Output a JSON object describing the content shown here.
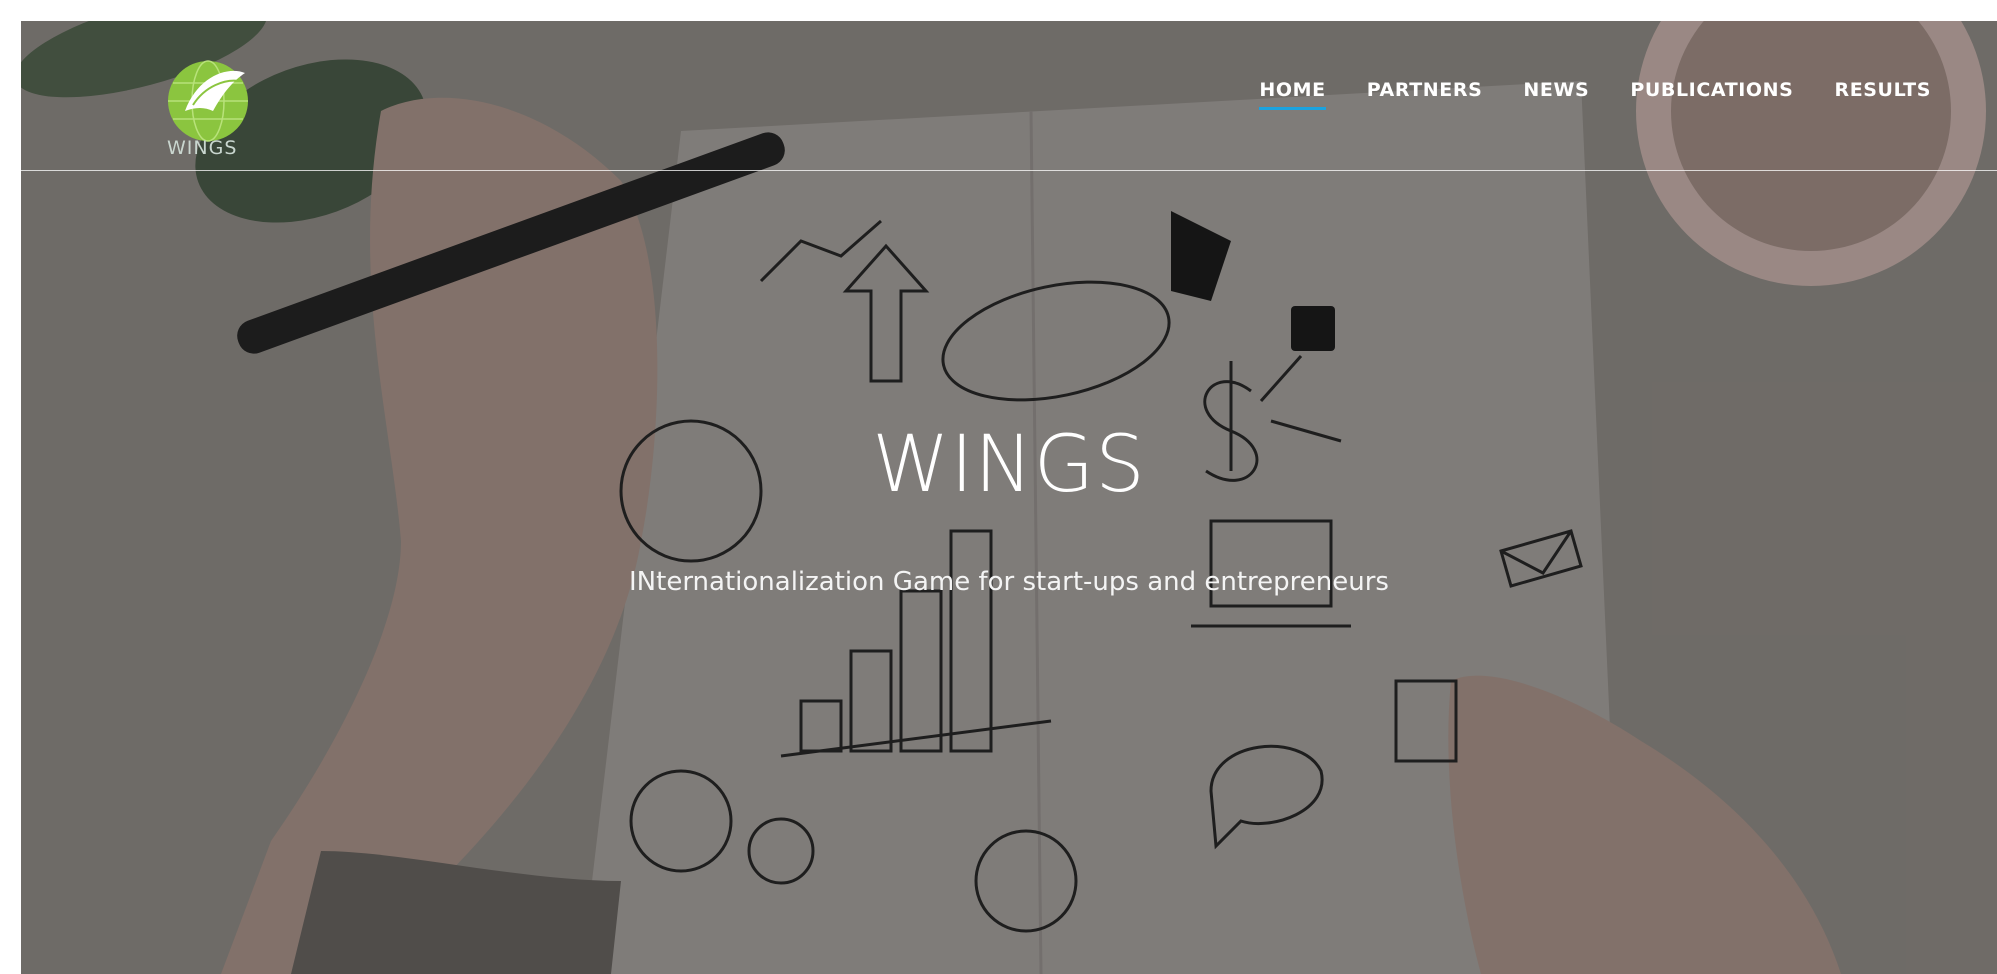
{
  "brand": {
    "logo_text": "WINGS",
    "logo_color": "#8bc53f"
  },
  "nav": {
    "items": [
      {
        "label": "HOME",
        "active": true
      },
      {
        "label": "PARTNERS",
        "active": false
      },
      {
        "label": "NEWS",
        "active": false
      },
      {
        "label": "PUBLICATIONS",
        "active": false
      },
      {
        "label": "RESULTS",
        "active": false
      }
    ],
    "active_color": "#1aa3e0"
  },
  "hero": {
    "title": "WINGS",
    "subtitle": "INternationalization Game for start-ups and entrepreneurs"
  }
}
